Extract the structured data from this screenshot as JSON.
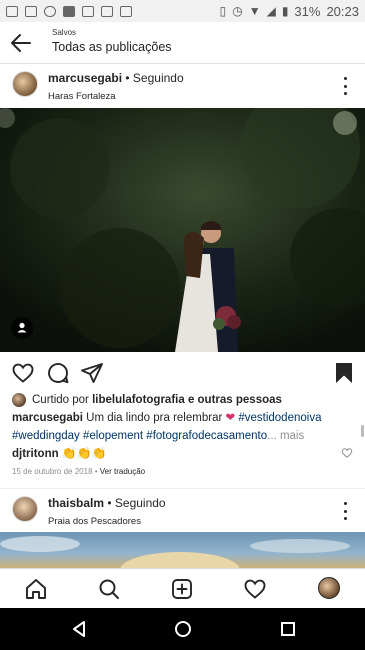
{
  "status_bar": {
    "battery": "31%",
    "time": "20:23"
  },
  "header": {
    "small_label": "Salvos",
    "title": "Todas as publicações"
  },
  "post": {
    "username": "marcusegabi",
    "separator": " • ",
    "follow_status": "Seguindo",
    "location": "Haras Fortaleza",
    "liked_by_prefix": "Curtido por ",
    "liked_by_user": "libelulafotografia",
    "liked_by_suffix": " e outras pessoas",
    "caption_user": "marcusegabi",
    "caption_text": "Um dia lindo pra relembrar",
    "caption_heart": "❤",
    "tags_line1_a": "#vestidodenoiva",
    "tags_line2_a": "#weddingday",
    "tags_line2_b": "#elopement",
    "tags_line2_c": "#fotografodecasamento",
    "ellipsis": "...",
    "more": "mais",
    "line3_user": "djtritonn",
    "line3_emoji": "👏👏👏",
    "date": "15 de outubro de 2018",
    "translate": "Ver tradução"
  },
  "post2": {
    "username": "thaisbalm",
    "separator": " • ",
    "follow_status": "Seguindo",
    "location": "Praia dos Pescadores"
  },
  "icons": {
    "back": "arrow-left-icon",
    "like": "heart-icon",
    "comment": "comment-icon",
    "share": "paper-plane-icon",
    "save": "bookmark-filled-icon",
    "home": "home-icon",
    "search": "search-icon",
    "new_post": "plus-square-icon",
    "activity": "heart-icon",
    "profile": "avatar"
  },
  "colors": {
    "hashtag": "#003569",
    "muted": "#8e8e8e",
    "text": "#262626"
  }
}
